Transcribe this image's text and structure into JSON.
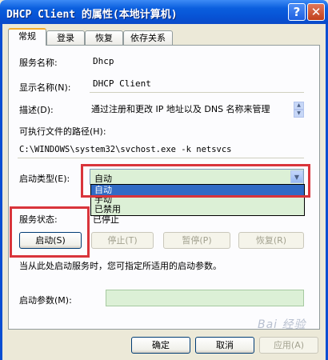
{
  "window": {
    "title": "DHCP Client 的属性(本地计算机)",
    "help_glyph": "?",
    "close_glyph": "✕"
  },
  "tabs": [
    "常规",
    "登录",
    "恢复",
    "依存关系"
  ],
  "general": {
    "service_name_label": "服务名称:",
    "service_name_value": "Dhcp",
    "display_name_label": "显示名称(N):",
    "display_name_value": "DHCP Client",
    "description_label": "描述(D):",
    "description_value": "通过注册和更改 IP 地址以及 DNS 名称来管理",
    "exe_path_label": "可执行文件的路径(H):",
    "exe_path_value": "C:\\WINDOWS\\system32\\svchost.exe -k netsvcs",
    "startup_type_label": "启动类型(E):",
    "startup_type_selected": "自动",
    "startup_type_options": [
      "自动",
      "手动",
      "已禁用"
    ],
    "service_status_label": "服务状态:",
    "service_status_value": "已停止",
    "start_button": "启动(S)",
    "stop_button": "停止(T)",
    "pause_button": "暂停(P)",
    "resume_button": "恢复(R)",
    "hint_text": "当从此处启动服务时，您可指定所适用的启动参数。",
    "start_params_label": "启动参数(M):",
    "start_params_value": ""
  },
  "footer": {
    "ok_button": "确定",
    "cancel_button": "取消",
    "apply_button": "应用(A)"
  },
  "watermark": "Bai 经验"
}
